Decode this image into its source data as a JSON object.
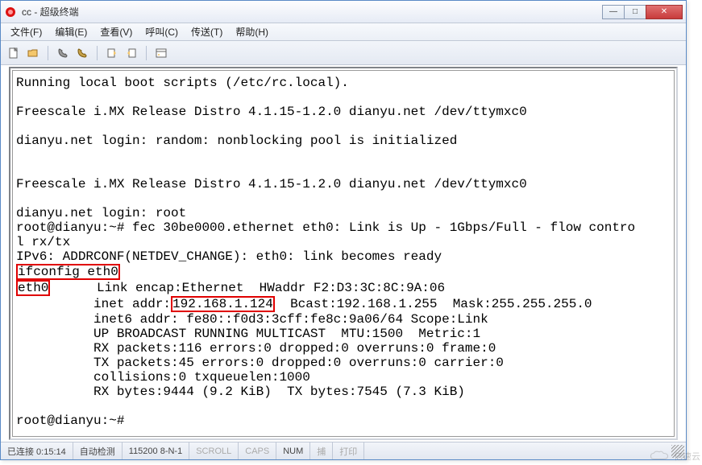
{
  "window": {
    "title": "cc - 超级终端",
    "controls": {
      "min": "—",
      "max": "□",
      "close": "✕"
    }
  },
  "menu": {
    "file": "文件(F)",
    "edit": "编辑(E)",
    "view": "查看(V)",
    "call": "呼叫(C)",
    "transfer": "传送(T)",
    "help": "帮助(H)"
  },
  "toolbar": {
    "icons": {
      "new": "new-doc-icon",
      "open": "open-folder-icon",
      "connect": "phone-connect-icon",
      "disconnect": "phone-disconnect-icon",
      "send": "send-file-icon",
      "receive": "receive-file-icon",
      "properties": "properties-icon"
    }
  },
  "terminal": {
    "lines": {
      "l1": "Running local boot scripts (/etc/rc.local).",
      "l2": "",
      "l3": "Freescale i.MX Release Distro 4.1.15-1.2.0 dianyu.net /dev/ttymxc0",
      "l4": "",
      "l5": "dianyu.net login: random: nonblocking pool is initialized",
      "l6": "",
      "l7": "",
      "l8": "Freescale i.MX Release Distro 4.1.15-1.2.0 dianyu.net /dev/ttymxc0",
      "l9": "",
      "l10": "dianyu.net login: root",
      "l11": "root@dianyu:~# fec 30be0000.ethernet eth0: Link is Up - 1Gbps/Full - flow contro",
      "l12": "l rx/tx",
      "l13": "IPv6: ADDRCONF(NETDEV_CHANGE): eth0: link becomes ready",
      "l14_cmd": "ifconfig eth0",
      "l15_if": "eth0",
      "l15_rest": "      Link encap:Ethernet  HWaddr F2:D3:3C:8C:9A:06",
      "l16_pre": "          inet addr:",
      "l16_ip": "192.168.1.124",
      "l16_post": "  Bcast:192.168.1.255  Mask:255.255.255.0",
      "l17": "          inet6 addr: fe80::f0d3:3cff:fe8c:9a06/64 Scope:Link",
      "l18": "          UP BROADCAST RUNNING MULTICAST  MTU:1500  Metric:1",
      "l19": "          RX packets:116 errors:0 dropped:0 overruns:0 frame:0",
      "l20": "          TX packets:45 errors:0 dropped:0 overruns:0 carrier:0",
      "l21": "          collisions:0 txqueuelen:1000",
      "l22": "          RX bytes:9444 (9.2 KiB)  TX bytes:7545 (7.3 KiB)",
      "l23": "",
      "l24": "root@dianyu:~#"
    }
  },
  "statusbar": {
    "connected": "已连接 0:15:14",
    "autodetect": "自动检测",
    "serial": "115200 8-N-1",
    "scroll": "SCROLL",
    "caps": "CAPS",
    "num": "NUM",
    "capture": "捕",
    "printecho": "打印"
  },
  "watermark": {
    "text": "亿速云"
  }
}
